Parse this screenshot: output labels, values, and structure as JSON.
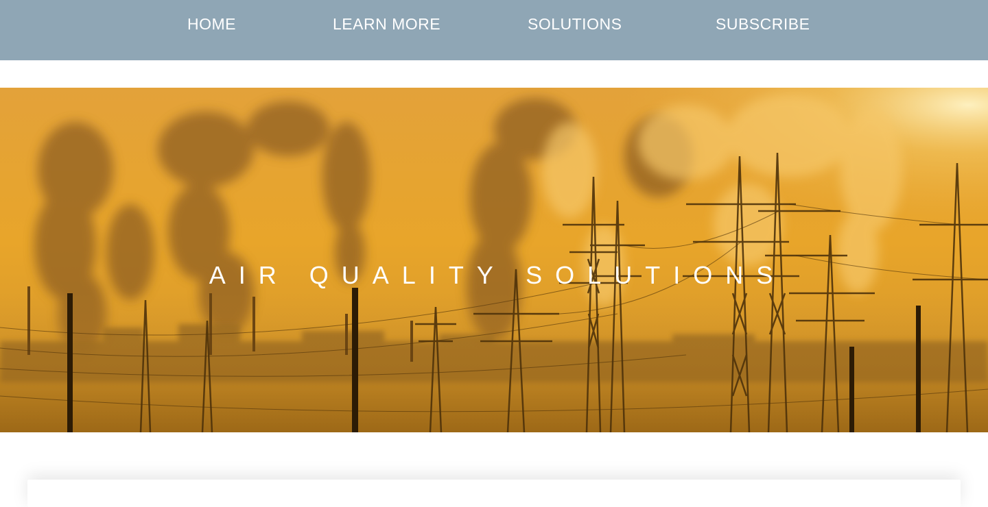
{
  "nav": {
    "items": [
      {
        "label": "HOME"
      },
      {
        "label": "LEARN MORE"
      },
      {
        "label": "SOLUTIONS"
      },
      {
        "label": "SUBSCRIBE"
      }
    ]
  },
  "hero": {
    "title": "AIR QUALITY SOLUTIONS",
    "image_subject": "industrial smokestacks and electricity pylons at orange sunset"
  },
  "colors": {
    "nav_background": "#8fa6b5",
    "nav_text": "#ffffff",
    "hero_sky": "#e8a22c",
    "hero_shadow": "#8a5a12"
  }
}
